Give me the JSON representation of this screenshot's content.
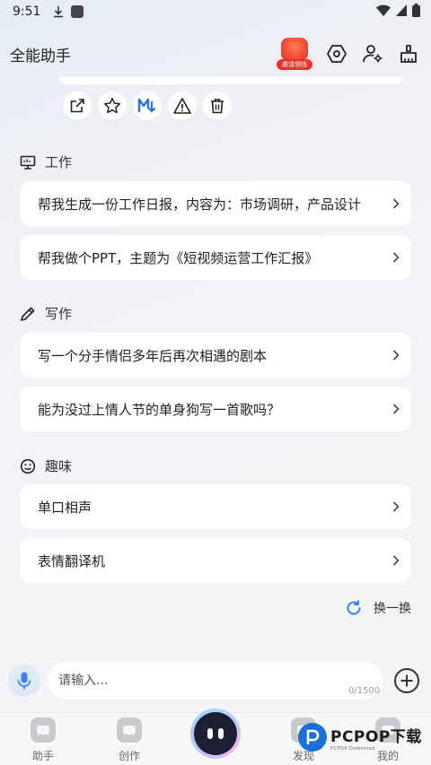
{
  "status_bar": {
    "time": "9:51"
  },
  "header": {
    "title": "全能助手",
    "promo_label": "邀请领钱"
  },
  "sections": [
    {
      "title": "工作",
      "items": [
        "帮我生成一份工作日报，内容为：市场调研，产品设计",
        "帮我做个PPT，主题为《短视频运营工作汇报》"
      ]
    },
    {
      "title": "写作",
      "items": [
        "写一个分手情侣多年后再次相遇的剧本",
        "能为没过上情人节的单身狗写一首歌吗？"
      ]
    },
    {
      "title": "趣味",
      "items": [
        "单口相声",
        "表情翻译机"
      ]
    }
  ],
  "refresh_label": "换一换",
  "input": {
    "placeholder": "请输入...",
    "counter": "0/1500"
  },
  "tabs": [
    {
      "label": "助手"
    },
    {
      "label": "创作"
    },
    {
      "label": "发现"
    },
    {
      "label": "我的"
    }
  ],
  "watermark": {
    "main": "PCPOP下载",
    "sub": "PCPOP Download"
  },
  "colors": {
    "accent": "#3b82f6",
    "card": "#ffffff",
    "mic_bg": "#dfeaf9"
  }
}
